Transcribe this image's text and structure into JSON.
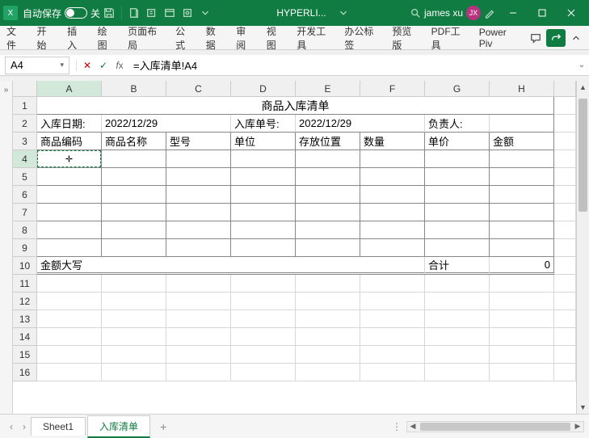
{
  "titlebar": {
    "autosave_label": "自动保存",
    "autosave_state": "关",
    "doc_title": "HYPERLI...",
    "user_name": "james xu",
    "user_initials": "JX"
  },
  "ribbon": {
    "tabs": [
      "文件",
      "开始",
      "插入",
      "绘图",
      "页面布局",
      "公式",
      "数据",
      "审阅",
      "视图",
      "开发工具",
      "办公标签",
      "预览版",
      "PDF工具",
      "Power Piv"
    ]
  },
  "formula_bar": {
    "name_box": "A4",
    "formula": "=入库清单!A4"
  },
  "columns": [
    "A",
    "B",
    "C",
    "D",
    "E",
    "F",
    "G",
    "H"
  ],
  "active_cell": "A4",
  "sheet": {
    "title": "商品入库清单",
    "row2": {
      "date_label": "入库日期:",
      "date_value": "2022/12/29",
      "order_label": "入库单号:",
      "order_value": "2022/12/29",
      "owner_label": "负责人:"
    },
    "headers": [
      "商品编码",
      "商品名称",
      "型号",
      "单位",
      "存放位置",
      "数量",
      "单价",
      "金额"
    ],
    "row10": {
      "cn_amount_label": "金额大写",
      "total_label": "合计",
      "total_value": "0"
    }
  },
  "sheet_tabs": [
    "Sheet1",
    "入库清单"
  ],
  "active_sheet_tab": "入库清单"
}
